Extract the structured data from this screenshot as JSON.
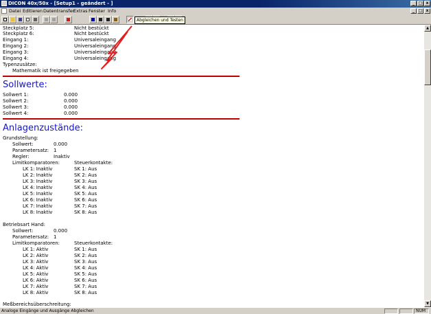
{
  "window": {
    "title": "DICON 40x/50x - [Setup1 - geändert - ]",
    "minimize": "_",
    "maximize": "□",
    "close": "x"
  },
  "menu": {
    "items": [
      "Datei",
      "Editieren",
      "Datentransfer",
      "Extras",
      "Fenster",
      "Info"
    ]
  },
  "tooltip": "Abgleichen und Testen",
  "document": {
    "slots": [
      {
        "label": "Steckplatz 5:",
        "value": "Nicht bestückt"
      },
      {
        "label": "Steckplatz 6:",
        "value": "Nicht bestückt"
      },
      {
        "label": "Eingang 1:",
        "value": "Universaleingang"
      },
      {
        "label": "Eingang 2:",
        "value": "Universaleingang"
      },
      {
        "label": "Eingang 3:",
        "value": "Universaleingang"
      },
      {
        "label": "Eingang 4:",
        "value": "Universaleingang"
      }
    ],
    "typenzusaetze_label": "Typenzusätze:",
    "typenzusaetze_value": "Mathematik ist freigegeben",
    "sollwerte_heading": "Sollwerte:",
    "sollwerte": [
      {
        "label": "Sollwert 1:",
        "value": "0.000"
      },
      {
        "label": "Sollwert 2:",
        "value": "0.000"
      },
      {
        "label": "Sollwert 3:",
        "value": "0.000"
      },
      {
        "label": "Sollwert 4:",
        "value": "0.000"
      }
    ],
    "anlagen_heading": "Anlagenzustände:",
    "grund": {
      "heading": "Grundstellung:",
      "fields": [
        {
          "label": "Sollwert:",
          "value": "0.000"
        },
        {
          "label": "Parametersatz:",
          "value": "1"
        },
        {
          "label": "Regler:",
          "value": "Inaktiv"
        }
      ],
      "lk_header": "Limitkomparatoren:",
      "sk_header": "Steuerkontakte:",
      "rows": [
        {
          "lk": "LK 1: Inaktiv",
          "sk": "SK 1: Aus"
        },
        {
          "lk": "LK 2: Inaktiv",
          "sk": "SK 2: Aus"
        },
        {
          "lk": "LK 3: Inaktiv",
          "sk": "SK 3: Aus"
        },
        {
          "lk": "LK 4: Inaktiv",
          "sk": "SK 4: Aus"
        },
        {
          "lk": "LK 5: Inaktiv",
          "sk": "SK 5: Aus"
        },
        {
          "lk": "LK 6: Inaktiv",
          "sk": "SK 6: Aus"
        },
        {
          "lk": "LK 7: Inaktiv",
          "sk": "SK 7: Aus"
        },
        {
          "lk": "LK 8: Inaktiv",
          "sk": "SK 8: Aus"
        }
      ]
    },
    "hand": {
      "heading": "Betriebsart Hand:",
      "fields": [
        {
          "label": "Sollwert:",
          "value": "0.000"
        },
        {
          "label": "Parametersatz:",
          "value": "1"
        }
      ],
      "lk_header": "Limitkomparatoren:",
      "sk_header": "Steuerkontakte:",
      "rows": [
        {
          "lk": "LK 1: Aktiv",
          "sk": "SK 1: Aus"
        },
        {
          "lk": "LK 2: Aktiv",
          "sk": "SK 2: Aus"
        },
        {
          "lk": "LK 3: Aktiv",
          "sk": "SK 3: Aus"
        },
        {
          "lk": "LK 4: Aktiv",
          "sk": "SK 4: Aus"
        },
        {
          "lk": "LK 5: Aktiv",
          "sk": "SK 5: Aus"
        },
        {
          "lk": "LK 6: Aktiv",
          "sk": "SK 6: Aus"
        },
        {
          "lk": "LK 7: Aktiv",
          "sk": "SK 7: Aus"
        },
        {
          "lk": "LK 8: Aktiv",
          "sk": "SK 8: Aus"
        }
      ]
    },
    "cutoff": "Meßbereichsüberschreitung:"
  },
  "status": {
    "message": "Analoge Eingänge und Ausgänge Abgleichen",
    "num": "NUM"
  },
  "colors": {
    "heading": "#1515c8",
    "rule": "#c00000",
    "annotation_arrow": "#e02020",
    "titlebar": "#0a246a"
  }
}
